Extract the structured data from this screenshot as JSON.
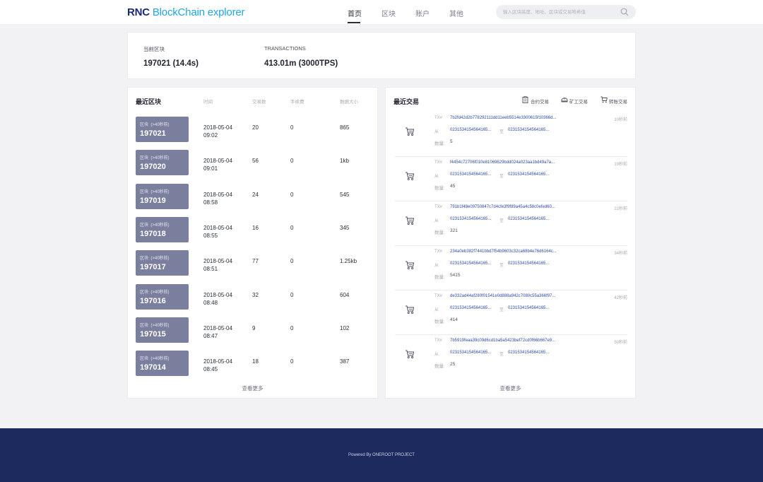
{
  "header": {
    "logo_bold": "RNC",
    "logo_rest": " BlockChain explorer",
    "nav": [
      {
        "label": "首页",
        "active": true
      },
      {
        "label": "区块",
        "active": false
      },
      {
        "label": "账户",
        "active": false
      },
      {
        "label": "其他",
        "active": false
      }
    ],
    "search_placeholder": "输入区块高度、地址、区块或交易哈希值",
    "search_value": ""
  },
  "stats": [
    {
      "label": "当前区块",
      "value": "197021 (14.4s)"
    },
    {
      "label": "TRANSACTIONS",
      "value": "413.01m (3000TPS)"
    }
  ],
  "blocks_panel": {
    "title": "最近区块",
    "columns": [
      "时间",
      "交易数",
      "手续费",
      "数据大小"
    ],
    "rows": [
      {
        "label": "区块",
        "ago": "(>40秒前)",
        "height": "197021",
        "date": "2018-05-04",
        "time": "09:02",
        "txs": "20",
        "fee": "0",
        "size": "865"
      },
      {
        "label": "区块",
        "ago": "(>40秒前)",
        "height": "197020",
        "date": "2018-05-04",
        "time": "09:01",
        "txs": "56",
        "fee": "0",
        "size": "1kb"
      },
      {
        "label": "区块",
        "ago": "(>40秒前)",
        "height": "197019",
        "date": "2018-05-04",
        "time": "08:58",
        "txs": "24",
        "fee": "0",
        "size": "545"
      },
      {
        "label": "区块",
        "ago": "(>40秒前)",
        "height": "197018",
        "date": "2018-05-04",
        "time": "08:55",
        "txs": "16",
        "fee": "0",
        "size": "345"
      },
      {
        "label": "区块",
        "ago": "(>40秒前)",
        "height": "197017",
        "date": "2018-05-04",
        "time": "08:51",
        "txs": "77",
        "fee": "0",
        "size": "1.25kb"
      },
      {
        "label": "区块",
        "ago": "(>40秒前)",
        "height": "197016",
        "date": "2018-05-04",
        "time": "08:48",
        "txs": "32",
        "fee": "0",
        "size": "604"
      },
      {
        "label": "区块",
        "ago": "(>40秒前)",
        "height": "197015",
        "date": "2018-05-04",
        "time": "08:47",
        "txs": "9",
        "fee": "0",
        "size": "102"
      },
      {
        "label": "区块",
        "ago": "(>40秒前)",
        "height": "197014",
        "date": "2018-05-04",
        "time": "08:45",
        "txs": "18",
        "fee": "0",
        "size": "387"
      }
    ],
    "view_more": "查看更多"
  },
  "tx_panel": {
    "title": "最近交易",
    "links": [
      {
        "label": "合约交易",
        "icon": "contract-icon"
      },
      {
        "label": "矿工交易",
        "icon": "miner-icon"
      },
      {
        "label": "转账交易",
        "icon": "cart-icon"
      }
    ],
    "labels": {
      "hash": "TX#",
      "from": "从",
      "to": "至",
      "qty": "数量:"
    },
    "rows": [
      {
        "hash": "7b2fd42d2b778292111dd11eeb5514e3300615f10366d...",
        "time": "10秒前",
        "from": "0231534154564165...",
        "to": "0231534154564165...",
        "qty": "5"
      },
      {
        "hash": "f4454c72706f010e81069629bdd024a023aa1bd49a7a...",
        "time": "19秒前",
        "from": "0231534154564165...",
        "to": "0231534154564165...",
        "qty": "45"
      },
      {
        "hash": "791b1f48e09750847c7d4cfe3f9f89a45a4c58c0efed60...",
        "time": "22秒前",
        "from": "0231534154564165...",
        "to": "0231534154564165...",
        "qty": "321"
      },
      {
        "hash": "234a0eb382f7441bbd7f54b9603c32ca68b4e76d6164c...",
        "time": "34秒前",
        "from": "0231534154564165...",
        "to": "0231534154564165...",
        "qty": "5415"
      },
      {
        "hash": "de332ad44af280f01541e0d888a942c7080c55a366f97...",
        "time": "42秒前",
        "from": "0231534154564165...",
        "to": "0231534154564165...",
        "qty": "414"
      },
      {
        "hash": "7b5919feaa39c09d6cd1ba5a5423bef72cd0f66b667e9...",
        "time": "50秒前",
        "from": "0231534154564165...",
        "to": "0231534154564165...",
        "qty": "25"
      }
    ],
    "view_more": "查看更多"
  },
  "footer": {
    "text": "Powered By ONEROOT PROJECT"
  },
  "colors": {
    "brand_dark": "#1a2a78",
    "brand_light": "#23a6e0",
    "badge": "#7b7f9e",
    "link": "#2d4aa8",
    "footer": "#1d2a5e"
  }
}
